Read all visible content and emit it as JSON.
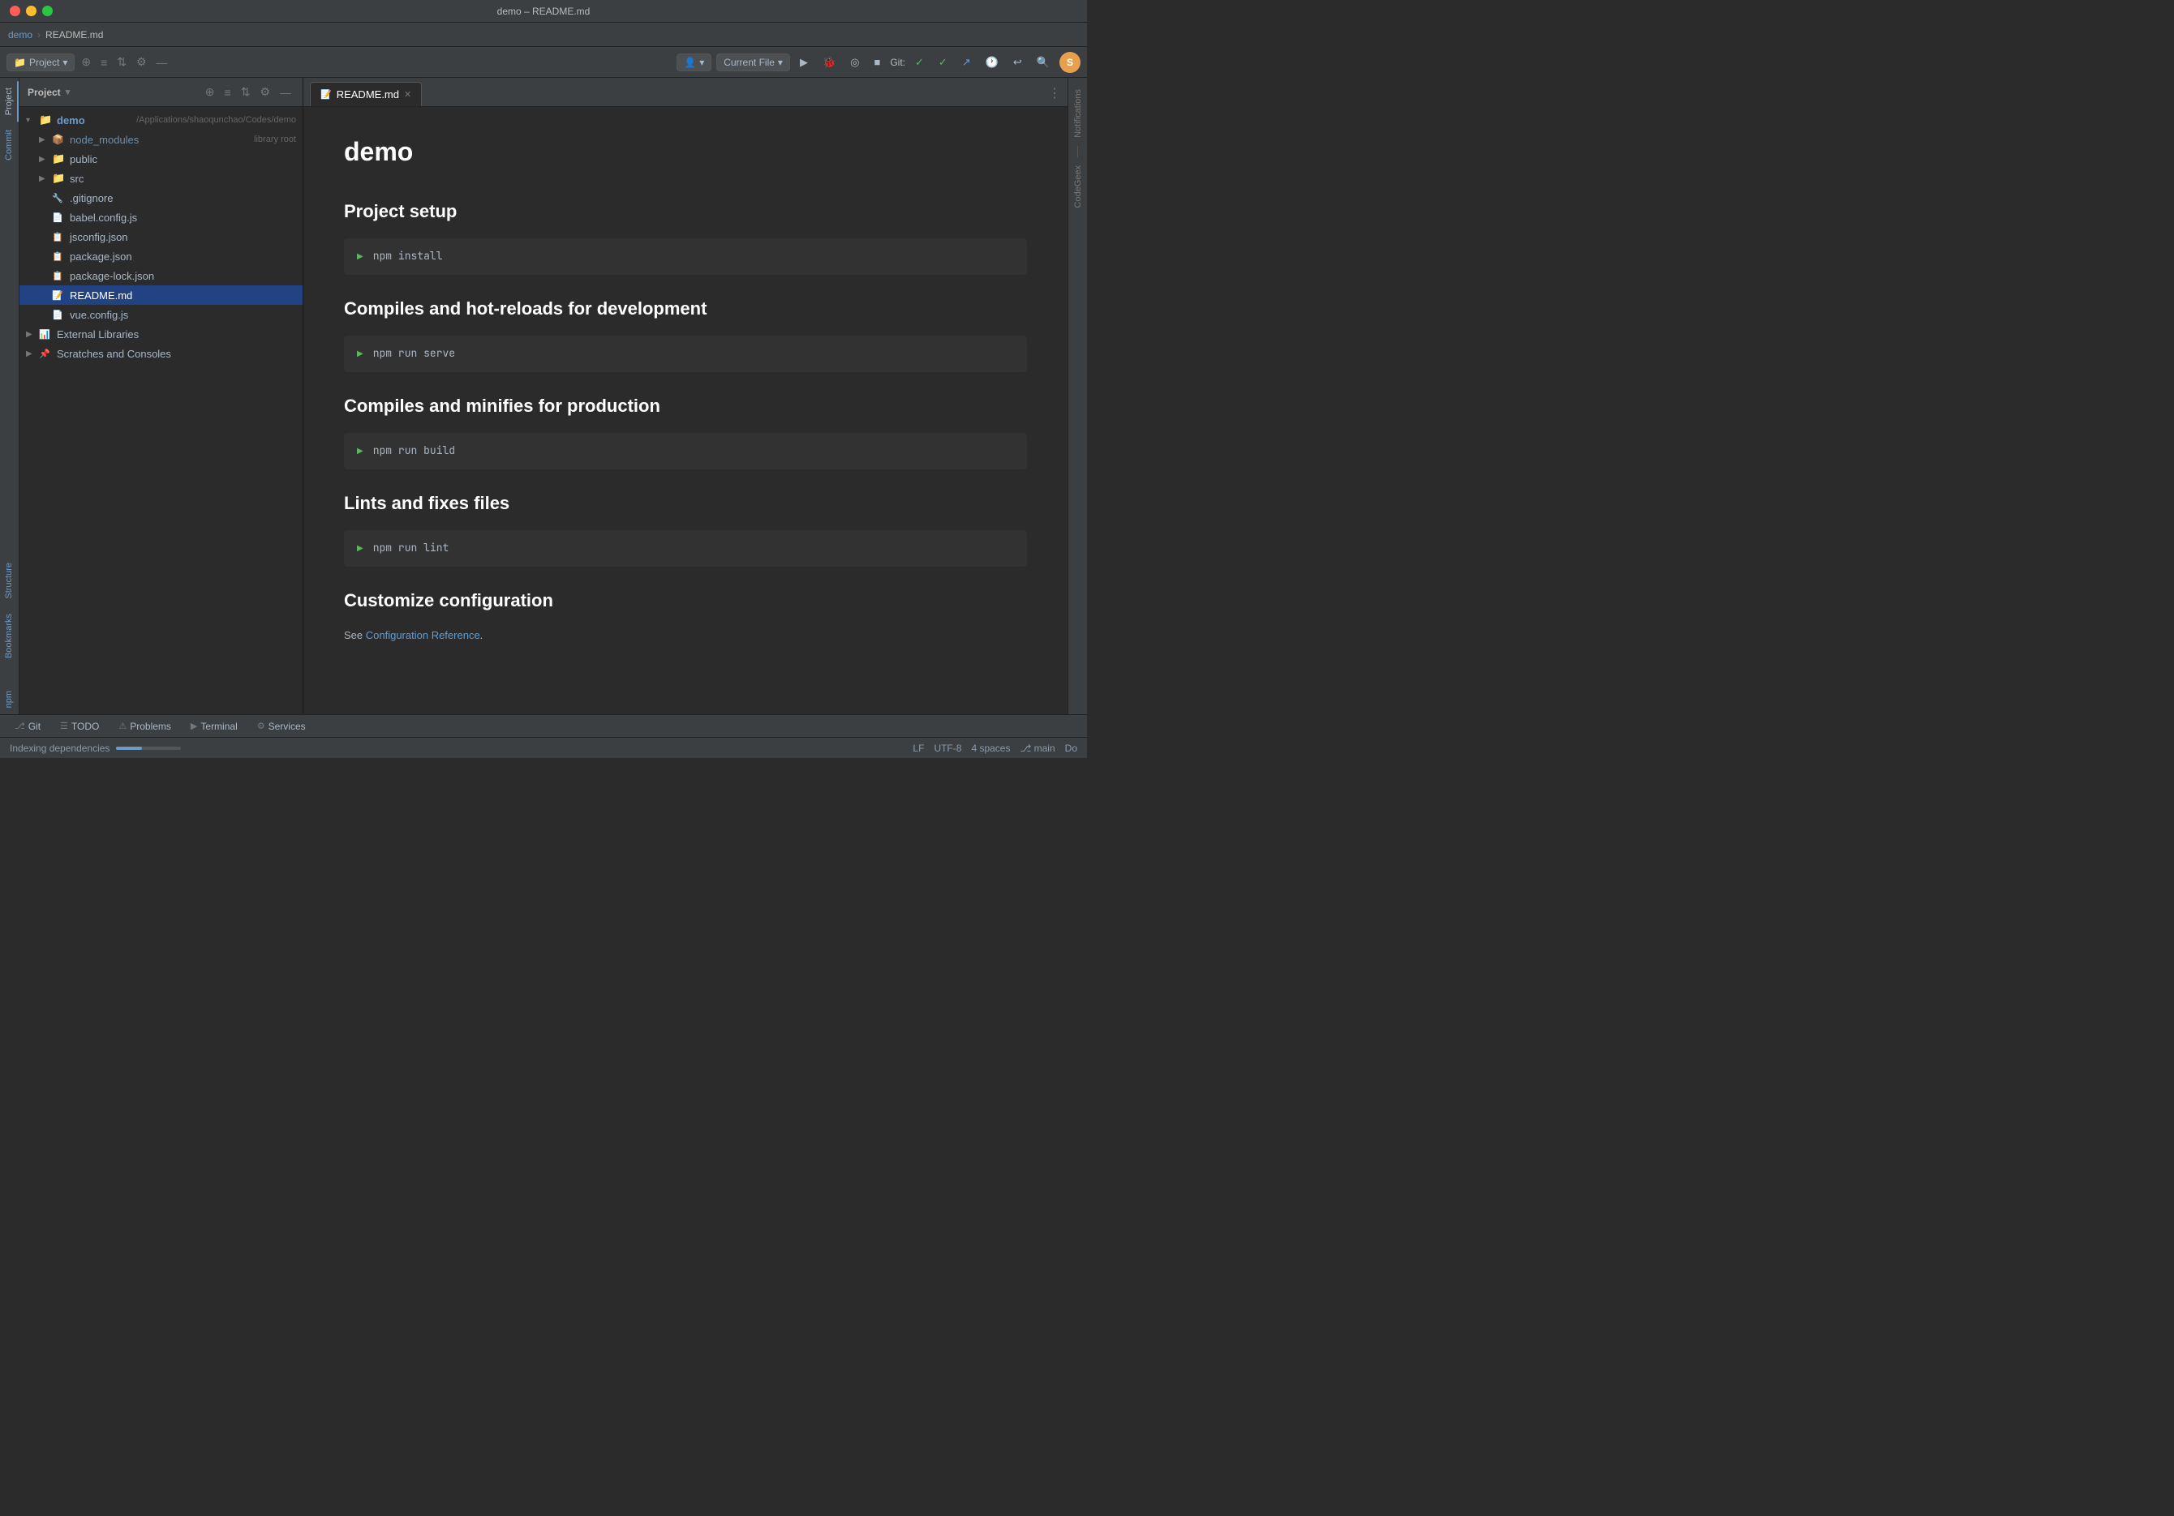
{
  "window": {
    "title": "demo – README.md"
  },
  "breadcrumb": {
    "project": "demo",
    "separator": " / ",
    "file": "README.md"
  },
  "toolbar": {
    "project_dropdown": "Project",
    "current_file_dropdown": "Current File",
    "git_label": "Git:",
    "user_avatar_initials": "S",
    "more_label": "⋮"
  },
  "file_panel": {
    "title": "Project",
    "root_label": "demo",
    "root_path": "/Applications/shaoqunchao/Codes/demo",
    "items": [
      {
        "id": "node_modules",
        "label": "node_modules",
        "sublabel": "library root",
        "type": "folder-special",
        "level": 1,
        "collapsed": true
      },
      {
        "id": "public",
        "label": "public",
        "type": "folder",
        "level": 1,
        "collapsed": true
      },
      {
        "id": "src",
        "label": "src",
        "type": "folder",
        "level": 1,
        "collapsed": true
      },
      {
        "id": "gitignore",
        "label": ".gitignore",
        "type": "file-git",
        "level": 1
      },
      {
        "id": "babel_config",
        "label": "babel.config.js",
        "type": "file-js",
        "level": 1
      },
      {
        "id": "jsconfig",
        "label": "jsconfig.json",
        "type": "file-json",
        "level": 1
      },
      {
        "id": "package_json",
        "label": "package.json",
        "type": "file-json",
        "level": 1
      },
      {
        "id": "package_lock",
        "label": "package-lock.json",
        "type": "file-json",
        "level": 1
      },
      {
        "id": "readme",
        "label": "README.md",
        "type": "file-md",
        "level": 1,
        "selected": true
      },
      {
        "id": "vue_config",
        "label": "vue.config.js",
        "type": "file-js",
        "level": 1
      },
      {
        "id": "external_libs",
        "label": "External Libraries",
        "type": "libraries",
        "level": 0
      },
      {
        "id": "scratches",
        "label": "Scratches and Consoles",
        "type": "scratches",
        "level": 0
      }
    ]
  },
  "tab_bar": {
    "tabs": [
      {
        "id": "readme",
        "label": "README.md",
        "active": true,
        "closeable": true
      }
    ]
  },
  "markdown": {
    "h1": "demo",
    "sections": [
      {
        "h2": "Project setup",
        "code": "npm install"
      },
      {
        "h2": "Compiles and hot-reloads for development",
        "code": "npm run serve"
      },
      {
        "h2": "Compiles and minifies for production",
        "code": "npm run build"
      },
      {
        "h2": "Lints and fixes files",
        "code": "npm run lint"
      },
      {
        "h2": "Customize configuration",
        "text": "See ",
        "link_text": "Configuration Reference",
        "text_after": "."
      }
    ]
  },
  "status_bar": {
    "indexing_label": "Indexing dependencies",
    "lf_label": "LF",
    "encoding_label": "UTF-8",
    "spaces_label": "4 spaces",
    "branch_label": "main",
    "do_label": "Do"
  },
  "bottom_tabs": [
    {
      "id": "git",
      "label": "Git",
      "icon": "⎇"
    },
    {
      "id": "todo",
      "label": "TODO",
      "icon": "☰"
    },
    {
      "id": "problems",
      "label": "Problems",
      "icon": "⚠"
    },
    {
      "id": "terminal",
      "label": "Terminal",
      "icon": "▶"
    },
    {
      "id": "services",
      "label": "Services",
      "icon": "⚙"
    }
  ],
  "right_sidebar_tabs": [
    {
      "id": "notifications",
      "label": "Notifications"
    },
    {
      "id": "codegex",
      "label": "CodeGeex"
    }
  ],
  "left_sidebar_tabs": [
    {
      "id": "project",
      "label": "Project",
      "active": true
    },
    {
      "id": "commit",
      "label": "Commit"
    },
    {
      "id": "bookmarks",
      "label": "Bookmarks"
    },
    {
      "id": "npm",
      "label": "npm"
    }
  ],
  "colors": {
    "accent_blue": "#6e9ac6",
    "background": "#2b2b2b",
    "panel_bg": "#3c3f41",
    "selected_bg": "#214283",
    "code_bg": "#323232"
  }
}
